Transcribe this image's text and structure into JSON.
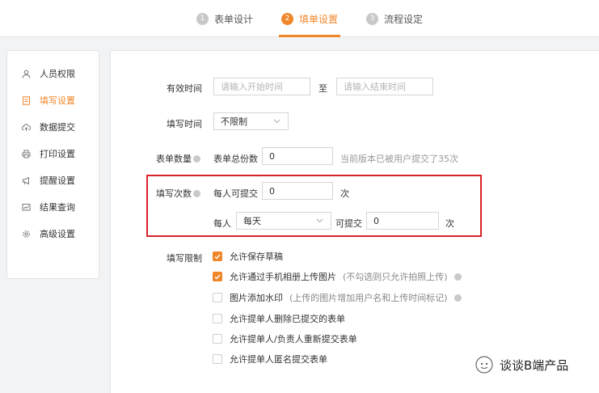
{
  "steps": [
    {
      "num": "1",
      "label": "表单设计"
    },
    {
      "num": "2",
      "label": "填单设置"
    },
    {
      "num": "3",
      "label": "流程设定"
    }
  ],
  "sidebar": {
    "items": [
      {
        "label": "人员权限",
        "icon": "person-icon"
      },
      {
        "label": "填写设置",
        "icon": "document-icon"
      },
      {
        "label": "数据提交",
        "icon": "cloud-upload-icon"
      },
      {
        "label": "打印设置",
        "icon": "printer-icon"
      },
      {
        "label": "提醒设置",
        "icon": "megaphone-icon"
      },
      {
        "label": "结果查询",
        "icon": "chart-icon"
      },
      {
        "label": "高级设置",
        "icon": "gear-icon"
      }
    ]
  },
  "form": {
    "valid_time": {
      "label": "有效时间",
      "start_placeholder": "请输入开始时间",
      "to": "至",
      "end_placeholder": "请输入结束时间"
    },
    "fill_time": {
      "label": "填写时间",
      "value": "不限制"
    },
    "form_count": {
      "label": "表单数量",
      "sublabel": "表单总份数",
      "value": "0",
      "hint": "当前版本已被用户提交了35次"
    },
    "fill_times": {
      "label": "填写次数",
      "per_person_label": "每人可提交",
      "per_person_value": "0",
      "unit": "次",
      "each_label": "每人",
      "period_value": "每天",
      "can_submit_label": "可提交",
      "period_count_value": "0",
      "unit2": "次"
    },
    "fill_limit": {
      "label": "填写限制",
      "options": [
        {
          "label": "允许保存草稿",
          "checked": true,
          "note": ""
        },
        {
          "label": "允许通过手机相册上传图片",
          "checked": true,
          "note": "(不勾选则只允许拍照上传)"
        },
        {
          "label": "图片添加水印",
          "checked": false,
          "note": "(上传的图片增加用户名和上传时间标记)"
        },
        {
          "label": "允许提单人删除已提交的表单",
          "checked": false,
          "note": ""
        },
        {
          "label": "允许提单人/负责人重新提交表单",
          "checked": false,
          "note": ""
        },
        {
          "label": "允许提单人匿名提交表单",
          "checked": false,
          "note": ""
        }
      ]
    }
  },
  "watermark": {
    "text": "谈谈B端产品"
  },
  "colors": {
    "accent": "#f0862a",
    "highlight_box": "#d8232a"
  }
}
